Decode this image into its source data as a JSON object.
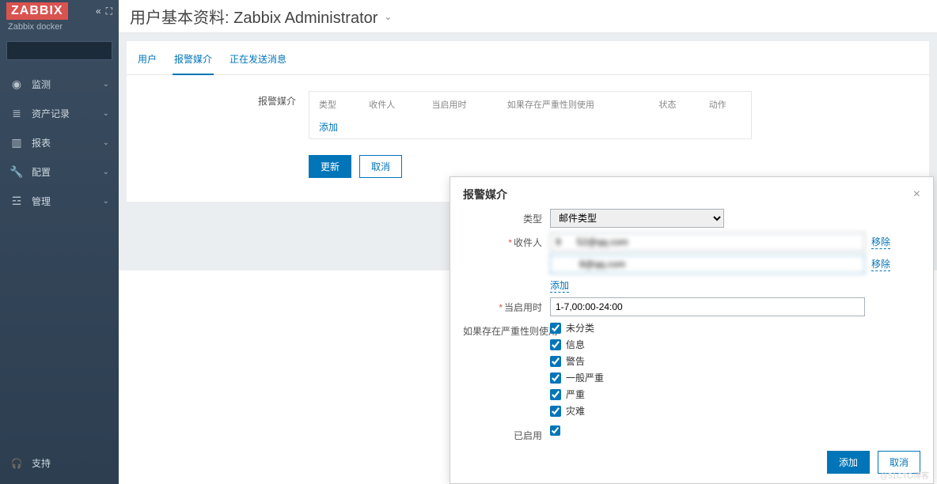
{
  "brand": {
    "logo": "ZABBIX",
    "subtitle": "Zabbix docker"
  },
  "sidebar": {
    "items": [
      {
        "icon": "◉",
        "label": "监测"
      },
      {
        "icon": "≣",
        "label": "资产记录"
      },
      {
        "icon": "▥",
        "label": "报表"
      },
      {
        "icon": "🔧",
        "label": "配置"
      },
      {
        "icon": "☲",
        "label": "管理"
      }
    ],
    "support": {
      "icon": "🎧",
      "label": "支持"
    }
  },
  "page": {
    "title": "用户基本资料: Zabbix Administrator",
    "tabs": [
      "用户",
      "报警媒介",
      "正在发送消息"
    ],
    "active_tab": 1
  },
  "media_section": {
    "label": "报警媒介",
    "headers": [
      "类型",
      "收件人",
      "当启用时",
      "如果存在严重性则使用",
      "状态",
      "动作"
    ],
    "add_label": "添加"
  },
  "buttons": {
    "update": "更新",
    "cancel": "取消"
  },
  "modal": {
    "title": "报警媒介",
    "type_label": "类型",
    "type_value": "邮件类型",
    "recipient_label": "收件人",
    "recipients": [
      {
        "value": "9      52@qq.com"
      },
      {
        "value": "         8@qq.com"
      }
    ],
    "remove_label": "移除",
    "add_label": "添加",
    "when_active_label": "当启用时",
    "when_active_value": "1-7,00:00-24:00",
    "severity_label": "如果存在严重性则使用",
    "severities": [
      {
        "label": "未分类",
        "checked": true
      },
      {
        "label": "信息",
        "checked": true
      },
      {
        "label": "警告",
        "checked": true
      },
      {
        "label": "一般严重",
        "checked": true
      },
      {
        "label": "严重",
        "checked": true
      },
      {
        "label": "灾难",
        "checked": true
      }
    ],
    "enabled_label": "已启用",
    "enabled": true,
    "add_button": "添加",
    "cancel_button": "取消"
  },
  "watermark": "@51CTO博客"
}
